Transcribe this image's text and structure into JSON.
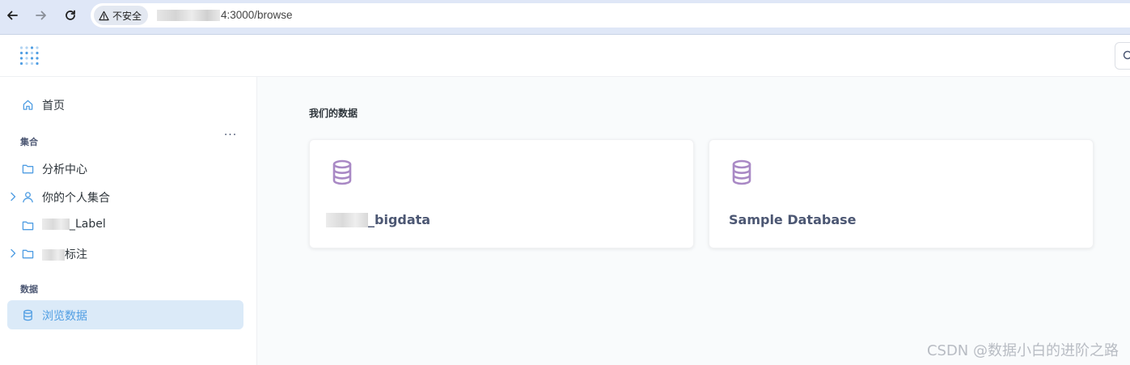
{
  "browser": {
    "security_label": "不安全",
    "url_suffix": "4:3000/browse"
  },
  "sidebar": {
    "home_label": "首页",
    "collections_heading": "集合",
    "more_label": "···",
    "items": [
      {
        "label": "分析中心"
      },
      {
        "label": "你的个人集合"
      },
      {
        "label": "_Label"
      },
      {
        "label": "标注"
      }
    ],
    "data_heading": "数据",
    "browse_label": "浏览数据"
  },
  "main": {
    "section_title": "我们的数据",
    "databases": [
      {
        "name": "_bigdata"
      },
      {
        "name": "Sample Database"
      }
    ]
  },
  "colors": {
    "accent": "#509ee3",
    "db_icon": "#a989c5",
    "active_bg": "#dbeaf8"
  },
  "watermark": "CSDN @数据小白的进阶之路"
}
